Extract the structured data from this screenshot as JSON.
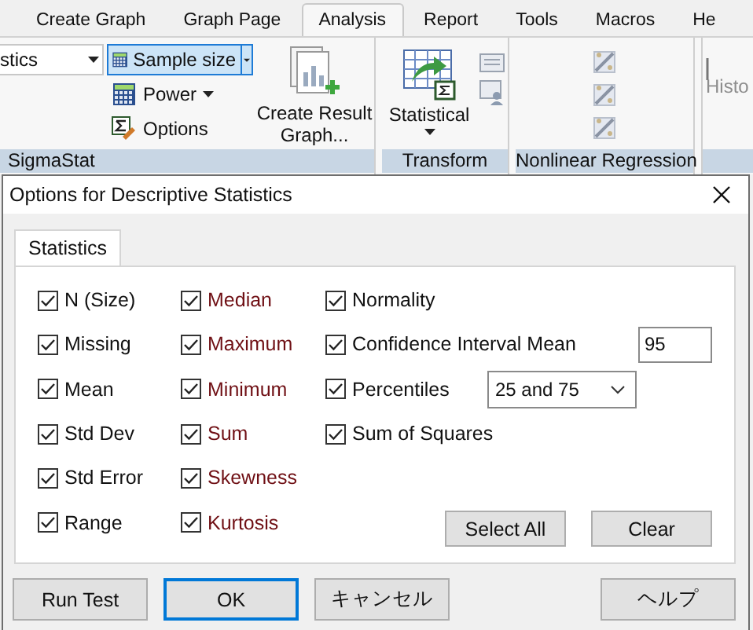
{
  "ribbon": {
    "tabs": [
      {
        "label": "Create Graph",
        "selected": false
      },
      {
        "label": "Graph Page",
        "selected": false
      },
      {
        "label": "Analysis",
        "selected": true
      },
      {
        "label": "Report",
        "selected": false
      },
      {
        "label": "Tools",
        "selected": false
      },
      {
        "label": "Macros",
        "selected": false
      },
      {
        "label": "He",
        "selected": false
      }
    ],
    "groups": [
      {
        "kind": "sigmastat",
        "label": "SigmaStat",
        "test_dropdown": "stics",
        "sample_size": {
          "label": "Sample size",
          "selected": true
        },
        "power": "Power",
        "options": "Options",
        "result_graph": [
          "Create Result",
          "Graph..."
        ]
      },
      {
        "kind": "transform",
        "label": "Transform",
        "statistical": "Statistical"
      },
      {
        "kind": "nonlinear",
        "label": "Nonlinear Regression"
      },
      {
        "kind": "partial",
        "item": "Histo",
        "disabled": true
      }
    ]
  },
  "dialog": {
    "title": "Options for Descriptive Statistics",
    "tab": {
      "label": "Statistics",
      "selected": true
    },
    "columns": [
      [
        {
          "kind": "check",
          "label": "N (Size)",
          "checked": true
        },
        {
          "kind": "check",
          "label": "Missing",
          "checked": true
        },
        {
          "kind": "check",
          "label": "Mean",
          "checked": true
        },
        {
          "kind": "check",
          "label": "Std Dev",
          "checked": true
        },
        {
          "kind": "check",
          "label": "Std Error",
          "checked": true
        },
        {
          "kind": "check",
          "label": "Range",
          "checked": true
        }
      ],
      [
        {
          "kind": "check",
          "label": "Median",
          "checked": true
        },
        {
          "kind": "check",
          "label": "Maximum",
          "checked": true
        },
        {
          "kind": "check",
          "label": "Minimum",
          "checked": true
        },
        {
          "kind": "check",
          "label": "Sum",
          "checked": true
        },
        {
          "kind": "check",
          "label": "Skewness",
          "checked": true
        },
        {
          "kind": "check",
          "label": "Kurtosis",
          "checked": true
        }
      ],
      [
        {
          "kind": "check",
          "label": "Normality",
          "checked": true
        },
        {
          "kind": "input",
          "label": "Confidence Interval Mean",
          "checked": true,
          "value": "95"
        },
        {
          "kind": "select",
          "label": "Percentiles",
          "checked": true,
          "value": "25 and 75"
        },
        {
          "kind": "check",
          "label": "Sum of Squares",
          "checked": true
        }
      ]
    ],
    "panel_buttons": [
      "Select All",
      "Clear"
    ],
    "footer_buttons": [
      {
        "label": "Run Test",
        "focused": false
      },
      {
        "label": "OK",
        "focused": true
      },
      {
        "label": "キャンセル",
        "focused": false
      }
    ],
    "help_button": {
      "label": "ヘルプ",
      "focused": false
    }
  }
}
